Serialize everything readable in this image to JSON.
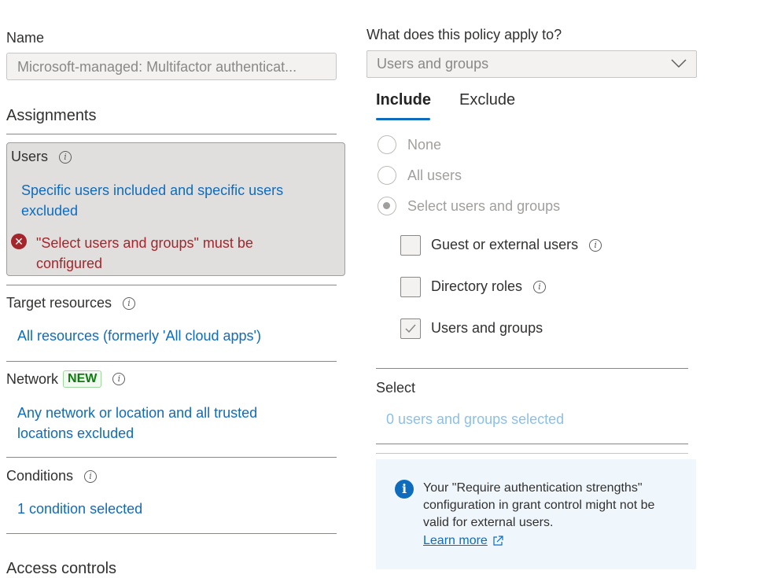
{
  "left": {
    "name_label": "Name",
    "name_value": "Microsoft-managed: Multifactor authenticat...",
    "assignments_heading": "Assignments",
    "users": {
      "label": "Users",
      "summary": "Specific users included and specific users excluded",
      "error": "\"Select users and groups\" must be configured"
    },
    "target_resources": {
      "label": "Target resources",
      "value": "All resources (formerly 'All cloud apps')"
    },
    "network": {
      "label": "Network",
      "badge": "NEW",
      "value": "Any network or location and all trusted locations excluded"
    },
    "conditions": {
      "label": "Conditions",
      "value": "1 condition selected"
    },
    "access_controls_heading": "Access controls"
  },
  "right": {
    "apply_label": "What does this policy apply to?",
    "apply_value": "Users and groups",
    "tabs": [
      {
        "label": "Include",
        "selected": true
      },
      {
        "label": "Exclude",
        "selected": false
      }
    ],
    "radios": [
      {
        "label": "None",
        "checked": false
      },
      {
        "label": "All users",
        "checked": false
      },
      {
        "label": "Select users and groups",
        "checked": true
      }
    ],
    "checkboxes": [
      {
        "label": "Guest or external users",
        "checked": false,
        "info": true
      },
      {
        "label": "Directory roles",
        "checked": false,
        "info": true
      },
      {
        "label": "Users and groups",
        "checked": true,
        "info": false
      }
    ],
    "select_label": "Select",
    "select_value": "0 users and groups selected",
    "info_message": "Your \"Require authentication strengths\" configuration in grant control might not be valid for external users.",
    "learn_more": "Learn more"
  },
  "colors": {
    "link": "#0f6cbd",
    "error": "#a4262c",
    "badge_bg": "#f1faf1",
    "badge_text": "#107c10",
    "info_bg": "#eff6fc",
    "info_icon": "#0f6cbd"
  }
}
